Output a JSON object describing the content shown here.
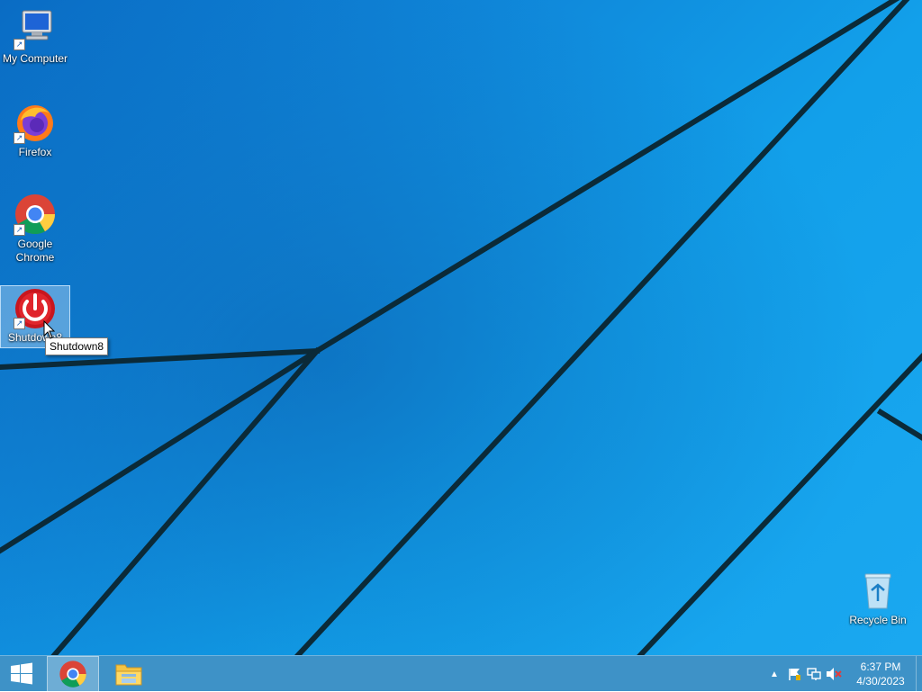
{
  "desktop": {
    "icons": [
      {
        "label": "My Computer",
        "icon": "computer-icon"
      },
      {
        "label": "Firefox",
        "icon": "firefox-icon"
      },
      {
        "label": "Google Chrome",
        "icon": "chrome-icon"
      },
      {
        "label": "Shutdown8",
        "icon": "power-icon",
        "selected": true
      },
      {
        "label": "Recycle Bin",
        "icon": "recycle-bin-icon"
      }
    ],
    "tooltip": "Shutdown8"
  },
  "taskbar": {
    "start_icon": "windows-logo-icon",
    "pinned": [
      {
        "name": "Google Chrome",
        "icon": "chrome-icon",
        "active": true
      },
      {
        "name": "File Explorer",
        "icon": "folder-icon",
        "active": false
      }
    ],
    "tray": {
      "icons": [
        "show-hidden-icons-icon",
        "action-center-flag-icon",
        "network-icon",
        "volume-muted-icon"
      ],
      "time": "6:37 PM",
      "date": "4/30/2023"
    }
  },
  "colors": {
    "wallpaper": "#1095e0",
    "taskbar": "#3e92c7",
    "selection": "#b4d7f5"
  }
}
